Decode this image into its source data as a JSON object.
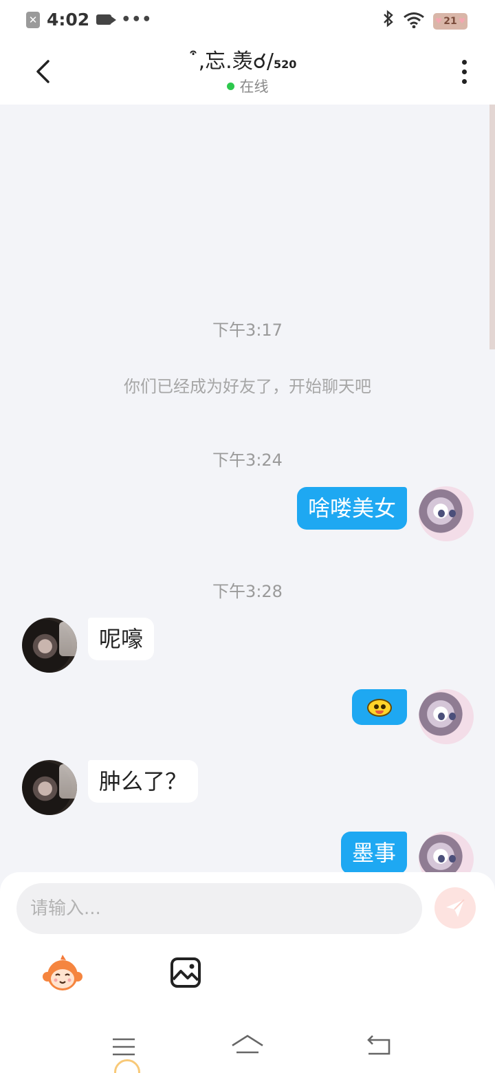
{
  "status_bar": {
    "time": "4:02",
    "more": "•••",
    "bluetooth_icon": "bluetooth-icon",
    "wifi_icon": "wifi-icon",
    "battery": "21"
  },
  "header": {
    "title": "͒,忘.羡☌/",
    "title_suffix": "520",
    "status": "在线"
  },
  "chat": {
    "items": [
      {
        "type": "timestamp",
        "text": "下午3:17"
      },
      {
        "type": "system",
        "text": "你们已经成为好友了，开始聊天吧"
      },
      {
        "type": "timestamp",
        "text": "下午3:24"
      },
      {
        "type": "out",
        "text": "啥喽美女"
      },
      {
        "type": "timestamp",
        "text": "下午3:28"
      },
      {
        "type": "in",
        "text": "呢嚎"
      },
      {
        "type": "out",
        "sticker": "yellow-face-emoji"
      },
      {
        "type": "in",
        "text": "肿么了？"
      },
      {
        "type": "out",
        "text": "墨事"
      }
    ]
  },
  "composer": {
    "placeholder": "请输入...",
    "value": ""
  },
  "colors": {
    "outgoing_bubble": "#1ea8f2",
    "incoming_bubble": "#ffffff",
    "online_dot": "#2dc84d",
    "send_button": "#fde3e0"
  }
}
